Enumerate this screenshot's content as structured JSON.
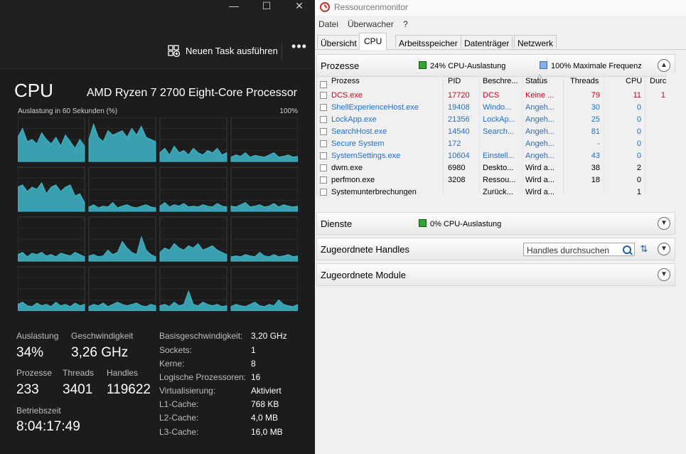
{
  "taskmanager": {
    "window_controls": [
      "—",
      "☐",
      "✕"
    ],
    "new_task_label": "Neuen Task ausführen",
    "more_label": "•••",
    "heading": "CPU",
    "cpu_model": "AMD Ryzen 7 2700 Eight-Core Processor",
    "graph_label": "Auslastung in 60 Sekunden (%)",
    "graph_max": "100%",
    "graph_color": "#3fb7c9",
    "core_levels": [
      [
        0.55,
        0.75,
        0.45,
        0.5,
        0.4,
        0.65,
        0.5,
        0.4,
        0.55,
        0.35,
        0.6,
        0.45,
        0.3,
        0.5,
        0.35
      ],
      [
        0.5,
        0.85,
        0.55,
        0.45,
        0.7,
        0.6,
        0.65,
        0.7,
        0.55,
        0.75,
        0.6,
        0.8,
        0.55,
        0.5,
        0.45
      ],
      [
        0.2,
        0.3,
        0.15,
        0.35,
        0.2,
        0.25,
        0.15,
        0.3,
        0.2,
        0.15,
        0.25,
        0.2,
        0.3,
        0.15,
        0.2
      ],
      [
        0.1,
        0.15,
        0.12,
        0.2,
        0.1,
        0.14,
        0.12,
        0.1,
        0.15,
        0.2,
        0.1,
        0.12,
        0.15,
        0.1,
        0.12
      ],
      [
        0.55,
        0.6,
        0.45,
        0.55,
        0.5,
        0.65,
        0.4,
        0.55,
        0.6,
        0.45,
        0.55,
        0.6,
        0.35,
        0.4,
        0.2
      ],
      [
        0.1,
        0.15,
        0.08,
        0.12,
        0.1,
        0.2,
        0.08,
        0.12,
        0.15,
        0.1,
        0.08,
        0.12,
        0.15,
        0.1,
        0.08
      ],
      [
        0.12,
        0.2,
        0.1,
        0.15,
        0.12,
        0.18,
        0.1,
        0.12,
        0.1,
        0.15,
        0.12,
        0.1,
        0.18,
        0.12,
        0.1
      ],
      [
        0.12,
        0.1,
        0.15,
        0.2,
        0.1,
        0.12,
        0.15,
        0.1,
        0.12,
        0.18,
        0.1,
        0.15,
        0.12,
        0.1,
        0.12
      ],
      [
        0.15,
        0.2,
        0.1,
        0.18,
        0.15,
        0.2,
        0.12,
        0.15,
        0.1,
        0.18,
        0.15,
        0.12,
        0.2,
        0.15,
        0.1
      ],
      [
        0.12,
        0.15,
        0.1,
        0.12,
        0.25,
        0.15,
        0.2,
        0.45,
        0.3,
        0.2,
        0.15,
        0.55,
        0.25,
        0.15,
        0.1
      ],
      [
        0.2,
        0.3,
        0.25,
        0.4,
        0.3,
        0.25,
        0.35,
        0.3,
        0.4,
        0.25,
        0.3,
        0.35,
        0.25,
        0.2,
        0.15
      ],
      [
        0.1,
        0.12,
        0.1,
        0.15,
        0.12,
        0.1,
        0.2,
        0.12,
        0.1,
        0.15,
        0.1,
        0.12,
        0.15,
        0.1,
        0.12
      ],
      [
        0.15,
        0.2,
        0.12,
        0.1,
        0.18,
        0.12,
        0.15,
        0.1,
        0.2,
        0.12,
        0.15,
        0.1,
        0.18,
        0.12,
        0.15
      ],
      [
        0.1,
        0.15,
        0.12,
        0.18,
        0.1,
        0.15,
        0.2,
        0.15,
        0.12,
        0.15,
        0.18,
        0.12,
        0.1,
        0.15,
        0.12
      ],
      [
        0.12,
        0.15,
        0.1,
        0.2,
        0.12,
        0.15,
        0.45,
        0.15,
        0.12,
        0.2,
        0.15,
        0.12,
        0.15,
        0.1,
        0.12
      ],
      [
        0.1,
        0.15,
        0.12,
        0.1,
        0.15,
        0.2,
        0.12,
        0.1,
        0.15,
        0.12,
        0.25,
        0.15,
        0.12,
        0.1,
        0.15
      ]
    ],
    "stats": {
      "auslastung_label": "Auslastung",
      "auslastung": "34%",
      "geschwindigkeit_label": "Geschwindigkeit",
      "geschwindigkeit": "3,26 GHz",
      "prozesse_label": "Prozesse",
      "prozesse": "233",
      "threads_label": "Threads",
      "threads": "3401",
      "handles_label": "Handles",
      "handles": "119622",
      "betriebszeit_label": "Betriebszeit",
      "betriebszeit": "8:04:17:49"
    },
    "info": [
      {
        "k": "Basisgeschwindigkeit:",
        "v": "3,20 GHz"
      },
      {
        "k": "Sockets:",
        "v": "1"
      },
      {
        "k": "Kerne:",
        "v": "8"
      },
      {
        "k": "Logische Prozessoren:",
        "v": "16"
      },
      {
        "k": "Virtualisierung:",
        "v": "Aktiviert"
      },
      {
        "k": "L1-Cache:",
        "v": "768 KB"
      },
      {
        "k": "L2-Cache:",
        "v": "4,0 MB"
      },
      {
        "k": "L3-Cache:",
        "v": "16,0 MB"
      }
    ]
  },
  "resmon": {
    "title": "Ressourcenmonitor",
    "menu": [
      "Datei",
      "Überwacher",
      "?"
    ],
    "tabs": [
      "Übersicht",
      "CPU",
      "Arbeitsspeicher",
      "Datenträger",
      "Netzwerk"
    ],
    "active_tab": "CPU",
    "processes": {
      "title": "Prozesse",
      "cpu_usage": "24% CPU-Auslastung",
      "max_freq": "100% Maximale Frequenz",
      "columns": [
        "Prozess",
        "PID",
        "Beschre...",
        "Status",
        "Threads",
        "CPU",
        "Durc"
      ],
      "rows": [
        {
          "name": "DCS.exe",
          "pid": "17720",
          "desc": "DCS",
          "status": "Keine ...",
          "threads": "79",
          "cpu": "11",
          "avg": "1",
          "color": "red"
        },
        {
          "name": "ShellExperienceHost.exe",
          "pid": "19408",
          "desc": "Windo...",
          "status": "Angeh...",
          "threads": "30",
          "cpu": "0",
          "avg": "",
          "color": "blue"
        },
        {
          "name": "LockApp.exe",
          "pid": "21356",
          "desc": "LockAp...",
          "status": "Angeh...",
          "threads": "25",
          "cpu": "0",
          "avg": "",
          "color": "blue"
        },
        {
          "name": "SearchHost.exe",
          "pid": "14540",
          "desc": "Search...",
          "status": "Angeh...",
          "threads": "81",
          "cpu": "0",
          "avg": "",
          "color": "blue"
        },
        {
          "name": "Secure System",
          "pid": "172",
          "desc": "",
          "status": "Angeh...",
          "threads": "-",
          "cpu": "0",
          "avg": "",
          "color": "blue"
        },
        {
          "name": "SystemSettings.exe",
          "pid": "10604",
          "desc": "Einstell...",
          "status": "Angeh...",
          "threads": "43",
          "cpu": "0",
          "avg": "",
          "color": "blue"
        },
        {
          "name": "dwm.exe",
          "pid": "6980",
          "desc": "Deskto...",
          "status": "Wird a...",
          "threads": "38",
          "cpu": "2",
          "avg": "",
          "color": "blk"
        },
        {
          "name": "perfmon.exe",
          "pid": "3208",
          "desc": "Ressou...",
          "status": "Wird a...",
          "threads": "18",
          "cpu": "0",
          "avg": "",
          "color": "blk"
        },
        {
          "name": "Systemunterbrechungen",
          "pid": "",
          "desc": "Zurück...",
          "status": "Wird a...",
          "threads": "",
          "cpu": "1",
          "avg": "",
          "color": "blk"
        }
      ]
    },
    "services": {
      "title": "Dienste",
      "cpu_usage": "0% CPU-Auslastung"
    },
    "handles": {
      "title": "Zugeordnete Handles",
      "search_placeholder": "Handles durchsuchen"
    },
    "modules": {
      "title": "Zugeordnete Module"
    }
  }
}
